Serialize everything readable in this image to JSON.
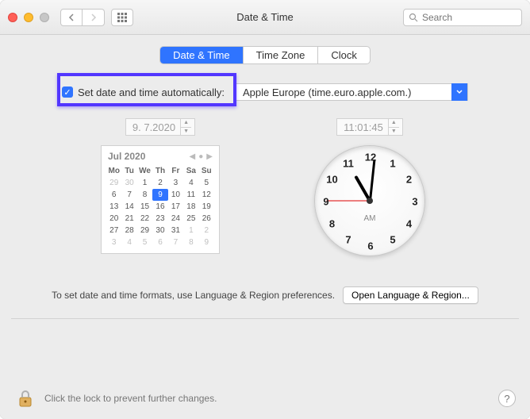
{
  "window": {
    "title": "Date & Time"
  },
  "search": {
    "placeholder": "Search"
  },
  "tabs": {
    "date_time": "Date & Time",
    "time_zone": "Time Zone",
    "clock": "Clock"
  },
  "auto": {
    "label": "Set date and time automatically:",
    "server": "Apple Europe (time.euro.apple.com.)"
  },
  "date_field": "9.  7.2020",
  "time_field": "11:01:45",
  "calendar": {
    "month_year": "Jul 2020",
    "dow": [
      "Mo",
      "Tu",
      "We",
      "Th",
      "Fr",
      "Sa",
      "Su"
    ],
    "cells": [
      {
        "d": "29",
        "out": true
      },
      {
        "d": "30",
        "out": true
      },
      {
        "d": "1"
      },
      {
        "d": "2"
      },
      {
        "d": "3"
      },
      {
        "d": "4"
      },
      {
        "d": "5"
      },
      {
        "d": "6"
      },
      {
        "d": "7"
      },
      {
        "d": "8"
      },
      {
        "d": "9",
        "sel": true
      },
      {
        "d": "10"
      },
      {
        "d": "11"
      },
      {
        "d": "12"
      },
      {
        "d": "13"
      },
      {
        "d": "14"
      },
      {
        "d": "15"
      },
      {
        "d": "16"
      },
      {
        "d": "17"
      },
      {
        "d": "18"
      },
      {
        "d": "19"
      },
      {
        "d": "20"
      },
      {
        "d": "21"
      },
      {
        "d": "22"
      },
      {
        "d": "23"
      },
      {
        "d": "24"
      },
      {
        "d": "25"
      },
      {
        "d": "26"
      },
      {
        "d": "27"
      },
      {
        "d": "28"
      },
      {
        "d": "29"
      },
      {
        "d": "30"
      },
      {
        "d": "31"
      },
      {
        "d": "1",
        "out": true
      },
      {
        "d": "2",
        "out": true
      },
      {
        "d": "3",
        "out": true
      },
      {
        "d": "4",
        "out": true
      },
      {
        "d": "5",
        "out": true
      },
      {
        "d": "6",
        "out": true
      },
      {
        "d": "7",
        "out": true
      },
      {
        "d": "8",
        "out": true
      },
      {
        "d": "9",
        "out": true
      }
    ]
  },
  "clock": {
    "ampm": "AM",
    "hour_angle": 330,
    "minute_angle": 6,
    "second_angle": 270,
    "numbers": [
      "12",
      "1",
      "2",
      "3",
      "4",
      "5",
      "6",
      "7",
      "8",
      "9",
      "10",
      "11"
    ]
  },
  "footer": {
    "note": "To set date and time formats, use Language & Region preferences.",
    "button": "Open Language & Region..."
  },
  "lock": {
    "text": "Click the lock to prevent further changes."
  },
  "help": "?"
}
